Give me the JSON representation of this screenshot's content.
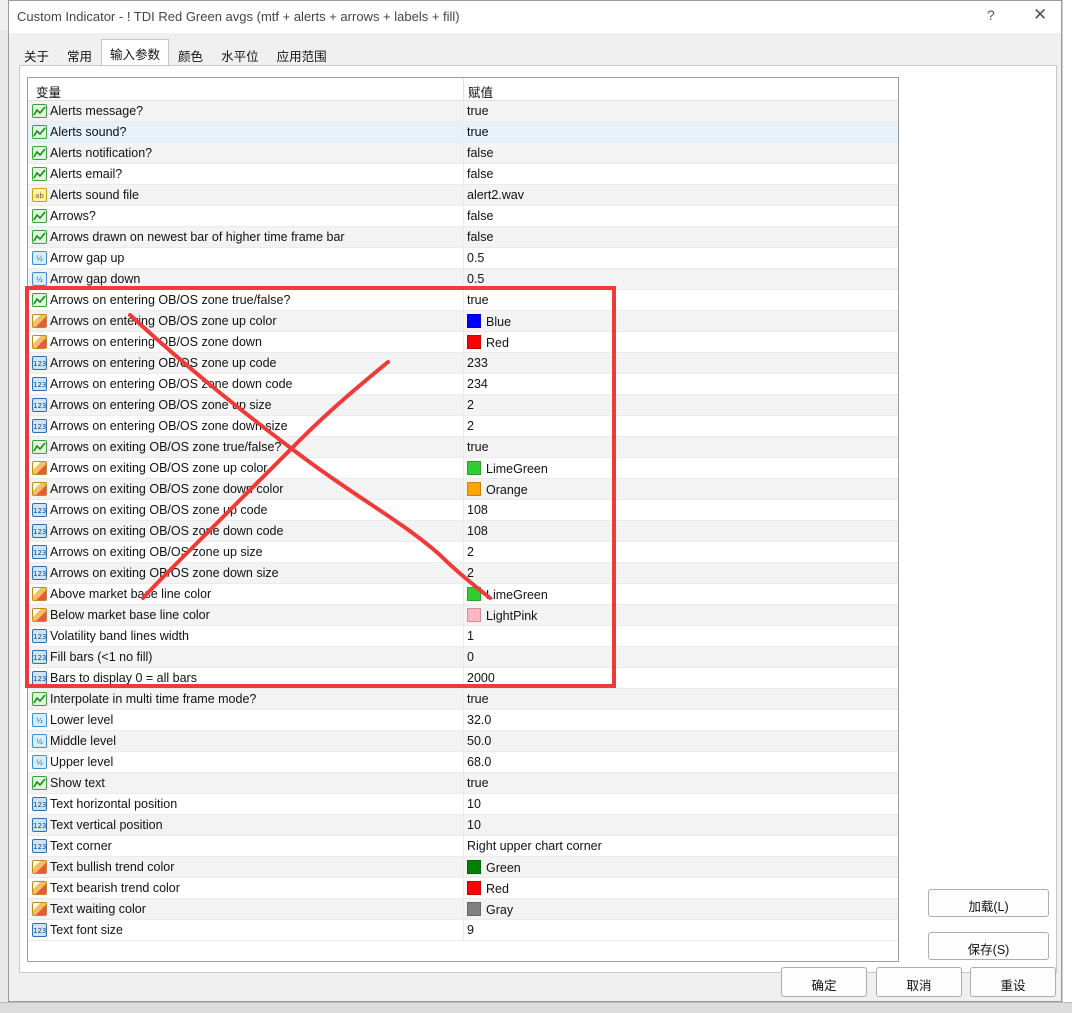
{
  "window": {
    "title": "Custom Indicator - ! TDI Red Green avgs  (mtf + alerts + arrows + labels + fill)",
    "help": "?",
    "close": "✕"
  },
  "tabs": [
    {
      "label": "关于"
    },
    {
      "label": "常用"
    },
    {
      "label": "输入参数",
      "active": true
    },
    {
      "label": "颜色"
    },
    {
      "label": "水平位"
    },
    {
      "label": "应用范围"
    }
  ],
  "grid": {
    "col_variable": "变量",
    "col_value": "赋值",
    "rows": [
      {
        "type": "bool",
        "name": "Alerts message?",
        "value": "true"
      },
      {
        "type": "bool",
        "name": "Alerts sound?",
        "value": "true"
      },
      {
        "type": "bool",
        "name": "Alerts notification?",
        "value": "false"
      },
      {
        "type": "bool",
        "name": "Alerts email?",
        "value": "false"
      },
      {
        "type": "str",
        "name": "Alerts sound file",
        "value": "alert2.wav"
      },
      {
        "type": "bool",
        "name": "Arrows?",
        "value": "false"
      },
      {
        "type": "bool",
        "name": "Arrows drawn on newest bar of higher time frame bar",
        "value": "false"
      },
      {
        "type": "dbl",
        "name": "Arrow gap up",
        "value": "0.5"
      },
      {
        "type": "dbl",
        "name": "Arrow gap down",
        "value": "0.5"
      },
      {
        "type": "bool",
        "name": "Arrows on entering OB/OS zone true/false?",
        "value": "true"
      },
      {
        "type": "clr",
        "name": "Arrows on entering OB/OS zone up color",
        "value": "Blue",
        "color": "#0000ff"
      },
      {
        "type": "clr",
        "name": "Arrows on entering OB/OS zone down",
        "value": "Red",
        "color": "#ff0000"
      },
      {
        "type": "int",
        "name": "Arrows on entering OB/OS zone up code",
        "value": "233"
      },
      {
        "type": "int",
        "name": "Arrows on entering OB/OS zone down code",
        "value": "234"
      },
      {
        "type": "int",
        "name": "Arrows on entering OB/OS zone up size",
        "value": "2"
      },
      {
        "type": "int",
        "name": "Arrows on entering OB/OS zone down size",
        "value": "2"
      },
      {
        "type": "bool",
        "name": "Arrows on exiting OB/OS zone true/false?",
        "value": "true"
      },
      {
        "type": "clr",
        "name": "Arrows on exiting OB/OS zone up color",
        "value": "LimeGreen",
        "color": "#32cd32"
      },
      {
        "type": "clr",
        "name": "Arrows on exiting OB/OS zone down color",
        "value": "Orange",
        "color": "#ffa500"
      },
      {
        "type": "int",
        "name": "Arrows on exiting OB/OS zone up code",
        "value": "108"
      },
      {
        "type": "int",
        "name": "Arrows on exiting OB/OS zone down code",
        "value": "108"
      },
      {
        "type": "int",
        "name": "Arrows on exiting OB/OS zone up size",
        "value": "2"
      },
      {
        "type": "int",
        "name": "Arrows on exiting OB/OS zone down size",
        "value": "2"
      },
      {
        "type": "clr",
        "name": "Above market base line color",
        "value": "LimeGreen",
        "color": "#32cd32"
      },
      {
        "type": "clr",
        "name": "Below market base line color",
        "value": "LightPink",
        "color": "#ffb6c1"
      },
      {
        "type": "int",
        "name": "Volatility band lines width",
        "value": "1"
      },
      {
        "type": "int",
        "name": "Fill bars (<1 no fill)",
        "value": "0"
      },
      {
        "type": "int",
        "name": "Bars to display 0 = all bars",
        "value": "2000"
      },
      {
        "type": "bool",
        "name": "Interpolate in multi time frame mode?",
        "value": "true"
      },
      {
        "type": "dbl",
        "name": "Lower level",
        "value": "32.0"
      },
      {
        "type": "dbl",
        "name": "Middle level",
        "value": "50.0"
      },
      {
        "type": "dbl",
        "name": "Upper level",
        "value": "68.0"
      },
      {
        "type": "bool",
        "name": "Show text",
        "value": "true"
      },
      {
        "type": "int",
        "name": "Text horizontal position",
        "value": "10"
      },
      {
        "type": "int",
        "name": "Text vertical position",
        "value": "10"
      },
      {
        "type": "int",
        "name": "Text corner",
        "value": "Right upper chart corner"
      },
      {
        "type": "clr",
        "name": "Text bullish trend color",
        "value": "Green",
        "color": "#008000"
      },
      {
        "type": "clr",
        "name": "Text bearish trend color",
        "value": "Red",
        "color": "#ff0000"
      },
      {
        "type": "clr",
        "name": "Text waiting color",
        "value": "Gray",
        "color": "#808080"
      },
      {
        "type": "int",
        "name": "Text font size",
        "value": "9"
      }
    ]
  },
  "buttons": {
    "load": "加载(L)",
    "save": "保存(S)",
    "ok": "确定",
    "cancel": "取消",
    "reset": "重设"
  },
  "annotation": {
    "color": "#f03a3a"
  }
}
